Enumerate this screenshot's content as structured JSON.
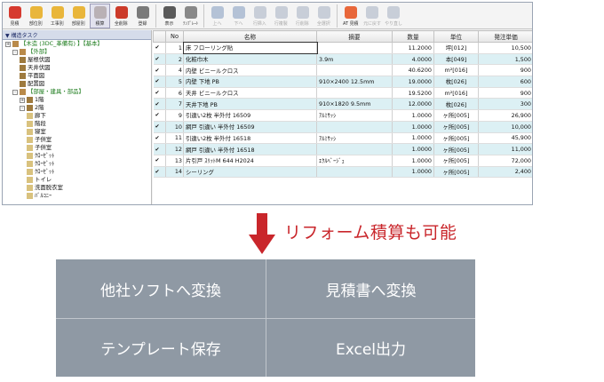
{
  "toolbar": {
    "buttons": [
      {
        "label": "見積",
        "icon": "red-circle-icon",
        "color": "#d63a2f"
      },
      {
        "label": "部位別",
        "icon": "folder-icon",
        "color": "#e9b63b"
      },
      {
        "label": "工事別",
        "icon": "folder-icon",
        "color": "#e9b63b"
      },
      {
        "label": "部屋別",
        "icon": "folder-icon",
        "color": "#e9b63b"
      },
      {
        "label": "積算",
        "icon": "page-icon",
        "color": "#b9b1b5"
      },
      {
        "label": "全削除",
        "icon": "cancel-icon",
        "color": "#cc3b2a"
      },
      {
        "label": "登録",
        "icon": "document-icon",
        "color": "#7a7a7a"
      },
      {
        "label": "表示",
        "icon": "grid-icon",
        "color": "#5a5a5a"
      },
      {
        "label": "ﾃﾝﾌﾟﾚｰﾄ",
        "icon": "template-icon",
        "color": "#888888"
      },
      {
        "label": "上へ",
        "icon": "up-arrow-icon",
        "color": "#b4c2d6"
      },
      {
        "label": "下へ",
        "icon": "down-arrow-icon",
        "color": "#b4c2d6"
      },
      {
        "label": "行挿入",
        "icon": "insert-icon",
        "color": "#c8ced8"
      },
      {
        "label": "行複製",
        "icon": "copy-icon",
        "color": "#c8ced8"
      },
      {
        "label": "行削除",
        "icon": "delete-row-icon",
        "color": "#c8ced8"
      },
      {
        "label": "全選択",
        "icon": "select-all-icon",
        "color": "#c8ced8"
      },
      {
        "label": "AT\n見積",
        "icon": "at-icon",
        "color": "#e8673a"
      },
      {
        "label": "元に戻す",
        "icon": "undo-icon",
        "color": "#c8ced8"
      },
      {
        "label": "やり直し",
        "icon": "redo-icon",
        "color": "#c8ced8"
      }
    ]
  },
  "tree": {
    "header": "▼ 構造タスク",
    "items": [
      {
        "label": "【木造 (3DC_革備有) 】【基本】",
        "indent": 0,
        "exp": "+",
        "color": "green"
      },
      {
        "label": "【外部】",
        "indent": 1,
        "exp": "-",
        "color": "green"
      },
      {
        "label": "屋根伏図",
        "indent": 2,
        "exp": "",
        "color": ""
      },
      {
        "label": "天井伏図",
        "indent": 2,
        "exp": "",
        "color": ""
      },
      {
        "label": "平面図",
        "indent": 2,
        "exp": "",
        "color": ""
      },
      {
        "label": "配置図",
        "indent": 2,
        "exp": "",
        "color": ""
      },
      {
        "label": "【部屋・建具・部品】",
        "indent": 1,
        "exp": "-",
        "color": "green"
      },
      {
        "label": "1階",
        "indent": 2,
        "exp": "+",
        "color": ""
      },
      {
        "label": "2階",
        "indent": 2,
        "exp": "-",
        "color": ""
      },
      {
        "label": "廊下",
        "indent": 3,
        "exp": "",
        "color": ""
      },
      {
        "label": "階段",
        "indent": 3,
        "exp": "",
        "color": ""
      },
      {
        "label": "寝室",
        "indent": 3,
        "exp": "",
        "color": ""
      },
      {
        "label": "子供室",
        "indent": 3,
        "exp": "",
        "color": ""
      },
      {
        "label": "子供室",
        "indent": 3,
        "exp": "",
        "color": ""
      },
      {
        "label": "ｸﾛｰｾﾞｯﾄ",
        "indent": 3,
        "exp": "",
        "color": ""
      },
      {
        "label": "ｸﾛｰｾﾞｯﾄ",
        "indent": 3,
        "exp": "",
        "color": ""
      },
      {
        "label": "ｸﾛｰｾﾞｯﾄ",
        "indent": 3,
        "exp": "",
        "color": ""
      },
      {
        "label": "トイレ",
        "indent": 3,
        "exp": "",
        "color": ""
      },
      {
        "label": "洗面脱衣室",
        "indent": 3,
        "exp": "",
        "color": ""
      },
      {
        "label": "ﾊﾞﾙｺﾆｰ",
        "indent": 3,
        "exp": "",
        "color": ""
      }
    ]
  },
  "grid": {
    "columns": [
      "",
      "No",
      "名称",
      "摘要",
      "数量",
      "単位",
      "発注単価"
    ],
    "rows": [
      {
        "check": "✔",
        "no": "1",
        "name": "床 フローリング貼",
        "summary": "",
        "qty": "11.2000",
        "unit": "坪[012]",
        "price": "10,500",
        "alt": false
      },
      {
        "check": "✔",
        "no": "2",
        "name": "化粧巾木",
        "summary": "3.9m",
        "qty": "4.0000",
        "unit": "本[049]",
        "price": "1,500",
        "alt": true
      },
      {
        "check": "✔",
        "no": "4",
        "name": "内壁 ビニールクロス",
        "summary": "",
        "qty": "40.6200",
        "unit": "m²[016]",
        "price": "900",
        "alt": false
      },
      {
        "check": "✔",
        "no": "5",
        "name": "内壁 下地 PB",
        "summary": "910×2400 12.5mm",
        "qty": "19.0000",
        "unit": "枚[026]",
        "price": "600",
        "alt": true
      },
      {
        "check": "✔",
        "no": "6",
        "name": "天井 ビニールクロス",
        "summary": "",
        "qty": "19.5200",
        "unit": "m²[016]",
        "price": "900",
        "alt": false
      },
      {
        "check": "✔",
        "no": "7",
        "name": "天井下地 PB",
        "summary": "910×1820 9.5mm",
        "qty": "12.0000",
        "unit": "枚[026]",
        "price": "300",
        "alt": true
      },
      {
        "check": "✔",
        "no": "9",
        "name": "引違い2枚 半外付 16509",
        "summary": "ｱﾙﾐｻｯｼ",
        "qty": "1.0000",
        "unit": "ヶ所[005]",
        "price": "26,900",
        "alt": false
      },
      {
        "check": "✔",
        "no": "10",
        "name": "網戸 引違い 半外付 16509",
        "summary": "",
        "qty": "1.0000",
        "unit": "ヶ所[005]",
        "price": "10,000",
        "alt": true
      },
      {
        "check": "✔",
        "no": "11",
        "name": "引違い2枚 半外付 16518",
        "summary": "ｱﾙﾐｻｯｼ",
        "qty": "1.0000",
        "unit": "ヶ所[005]",
        "price": "45,900",
        "alt": false
      },
      {
        "check": "✔",
        "no": "12",
        "name": "網戸 引違い 半外付 16518",
        "summary": "",
        "qty": "1.0000",
        "unit": "ヶ所[005]",
        "price": "11,000",
        "alt": true
      },
      {
        "check": "✔",
        "no": "13",
        "name": "片引戸 ｽﾘｯﾄM 644 H2024",
        "summary": "ｴｸﾙﾍﾞｰｼﾞｭ",
        "qty": "1.0000",
        "unit": "ヶ所[005]",
        "price": "72,000",
        "alt": false
      },
      {
        "check": "✔",
        "no": "14",
        "name": "シーリング",
        "summary": "",
        "qty": "1.0000",
        "unit": "ヶ所[005]",
        "price": "2,400",
        "alt": true
      }
    ]
  },
  "caption": "リフォーム積算も可能",
  "features": {
    "top_left": "他社ソフトへ変換",
    "top_right": "見積書へ変換",
    "bottom_left": "テンプレート保存",
    "bottom_right": "Excel出力"
  },
  "colors": {
    "accent_red": "#c9262b",
    "panel_bg": "#8f99a4",
    "row_alt": "#dcf0f4"
  }
}
